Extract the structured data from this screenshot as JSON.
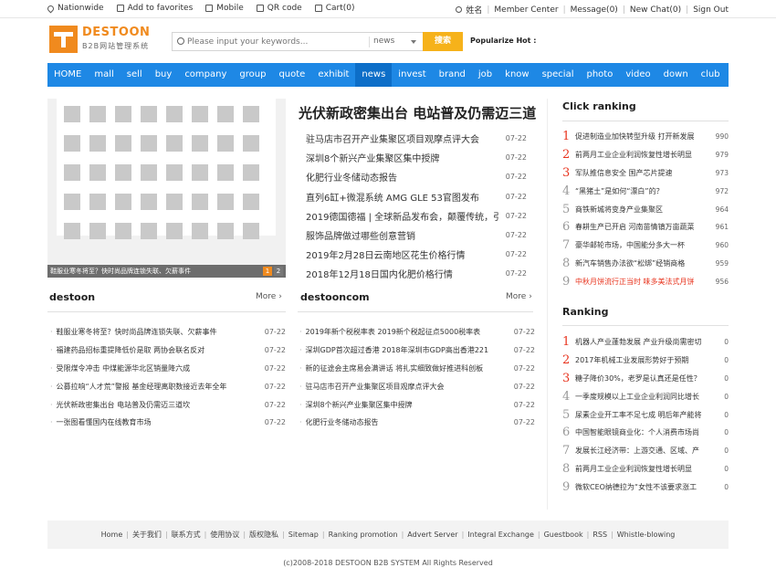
{
  "topbar": {
    "left": [
      {
        "label": "Nationwide",
        "icon": "location-pin-icon"
      },
      {
        "label": "Add to favorites",
        "icon": "favorite-icon"
      },
      {
        "label": "Mobile",
        "icon": "mobile-icon"
      },
      {
        "label": "QR code",
        "icon": "qr-code-icon"
      },
      {
        "label": "Cart(0)",
        "icon": "cart-icon"
      }
    ],
    "right": [
      "姓名",
      "Member Center",
      "Message(0)",
      "New Chat(0)",
      "Sign Out"
    ]
  },
  "header": {
    "logo_name": "DESTOON",
    "logo_sub": "B2B网站管理系统",
    "search_placeholder": "Please input your keywords...",
    "search_category": "news",
    "search_button": "搜索",
    "popular_label": "Popularize Hot :"
  },
  "nav": [
    "HOME",
    "mall",
    "sell",
    "buy",
    "company",
    "group",
    "quote",
    "exhibit",
    "news",
    "invest",
    "brand",
    "job",
    "know",
    "special",
    "photo",
    "video",
    "down",
    "club"
  ],
  "nav_active": "news",
  "slider": {
    "caption": "鞋服业寒冬将至？快时尚品牌连锁失联、欠薪事件",
    "pages": [
      "1",
      "2"
    ]
  },
  "headline": "光伏新政密集出台 电站普及仍需迈三道",
  "top_news": [
    {
      "title": "驻马店市召开产业集聚区项目观摩点评大会",
      "date": "07-22"
    },
    {
      "title": "深圳8个新兴产业集聚区集中授牌",
      "date": "07-22"
    },
    {
      "title": "化肥行业冬储动态报告",
      "date": "07-22"
    },
    {
      "title": "直列6缸+微混系统 AMG GLE 53官图发布",
      "date": "07-22"
    },
    {
      "title": "2019德国德福 | 全球新品发布会，颠覆传统，引",
      "date": "07-22"
    },
    {
      "title": "服饰品牌做过哪些创意营销",
      "date": "07-22"
    },
    {
      "title": "2019年2月28日云南地区花生价格行情",
      "date": "07-22"
    },
    {
      "title": "2018年12月18日国内化肥价格行情",
      "date": "07-22"
    }
  ],
  "section_destoon": {
    "title": "destoon",
    "more": "More",
    "items": [
      {
        "title": "鞋服业寒冬将至？快时尚品牌连锁失联、欠薪事件",
        "date": "07-22"
      },
      {
        "title": "福建药品招标重提降低价是取 两协会联名反对",
        "date": "07-22"
      },
      {
        "title": "受限煤令冲击 中煤能源华北区销量降六成",
        "date": "07-22"
      },
      {
        "title": "公募拉响“人才荒”警报 基金经理离职数接近去年全年",
        "date": "07-22"
      },
      {
        "title": "光伏新政密集出台 电站普及仍需迈三道坎",
        "date": "07-22"
      },
      {
        "title": "一张图看懂国内在线教育市场",
        "date": "07-22"
      }
    ]
  },
  "section_destooncom": {
    "title": "destooncom",
    "more": "More",
    "items": [
      {
        "title": "2019年新个税税率表 2019新个税起征点5000税率表",
        "date": "07-22"
      },
      {
        "title": "深圳GDP首次超过香港 2018年深圳市GDP高出香港221",
        "date": "07-22"
      },
      {
        "title": "新的征途会主席易会满讲话 将扎实细致做好推进科创板",
        "date": "07-22"
      },
      {
        "title": "驻马店市召开产业集聚区项目观摩点评大会",
        "date": "07-22"
      },
      {
        "title": "深圳8个新兴产业集聚区集中授牌",
        "date": "07-22"
      },
      {
        "title": "化肥行业冬储动态报告",
        "date": "07-22"
      }
    ]
  },
  "click_ranking": {
    "title": "Click ranking",
    "items": [
      {
        "n": "1",
        "title": "促进制造业加快转型升级 打开新发展",
        "count": "990"
      },
      {
        "n": "2",
        "title": "前两月工业企业利润恢复性增长明显",
        "count": "979"
      },
      {
        "n": "3",
        "title": "军队推信息安全 国产芯片提速",
        "count": "973"
      },
      {
        "n": "4",
        "title": "“黑猪土”是如何“漂白”的？",
        "count": "972"
      },
      {
        "n": "5",
        "title": "商铁新城将变身产业集聚区",
        "count": "964"
      },
      {
        "n": "6",
        "title": "春耕生产已开启 河南苗情镇万亩蔬菜",
        "count": "961"
      },
      {
        "n": "7",
        "title": "豪华邮轮市场，中国能分多大一杯",
        "count": "960"
      },
      {
        "n": "8",
        "title": "新汽车销售办法欲“松绑”经销商格",
        "count": "959"
      },
      {
        "n": "9",
        "title": "中秋月饼流行正当时 味多美法式月饼",
        "count": "956"
      }
    ]
  },
  "ranking": {
    "title": "Ranking",
    "items": [
      {
        "n": "1",
        "title": "机器人产业蓬勃发展 产业升级尚需密切",
        "count": "0"
      },
      {
        "n": "2",
        "title": "2017年机械工业发展形势好于预期",
        "count": "0"
      },
      {
        "n": "3",
        "title": "糖子降价30%，老罗是认真还是任性？",
        "count": "0"
      },
      {
        "n": "4",
        "title": "一季度规模以上工业企业利润同比增长",
        "count": "0"
      },
      {
        "n": "5",
        "title": "尿素企业开工率不足七成 明后年产能将",
        "count": "0"
      },
      {
        "n": "6",
        "title": "中国智能眼镜商业化：个人消费市场尚",
        "count": "0"
      },
      {
        "n": "7",
        "title": "发展长江经济带：上游交通、区域、产",
        "count": "0"
      },
      {
        "n": "8",
        "title": "前两月工业企业利润恢复性增长明显",
        "count": "0"
      },
      {
        "n": "9",
        "title": "微软CEO纳德拉为“女性不该要求涨工",
        "count": "0"
      }
    ]
  },
  "footer": {
    "links": [
      "Home",
      "关于我们",
      "联系方式",
      "使用协议",
      "版权隐私",
      "Sitemap",
      "Ranking promotion",
      "Advert Server",
      "Integral Exchange",
      "Guestbook",
      "RSS",
      "Whistle-blowing"
    ],
    "copyright": "(c)2008-2018 DESTOON B2B SYSTEM All Rights Reserved"
  },
  "colors": {
    "accent": "#1e88e5",
    "brand": "#f08a1e",
    "rank_highlight": "#e8341e",
    "search_button": "#f6b21a"
  }
}
